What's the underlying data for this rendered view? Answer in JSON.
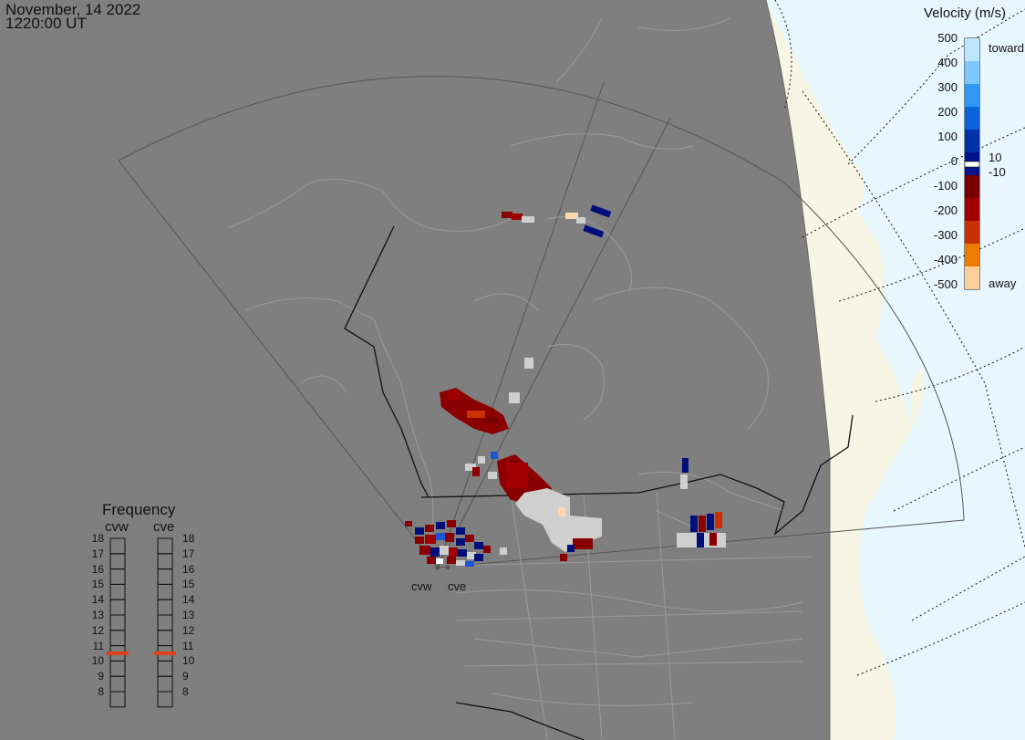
{
  "header": {
    "date": "November, 14 2022",
    "time": "1220:00 UT"
  },
  "velocity_scale": {
    "title": "Velocity (m/s)",
    "ticks": [
      "500",
      "400",
      "300",
      "200",
      "100",
      "0",
      "-100",
      "-200",
      "-300",
      "-400",
      "-500"
    ],
    "labels": {
      "toward": "toward",
      "away": "away",
      "plus_ten": "10",
      "minus_ten": "-10"
    },
    "colors": [
      "#bfe6ff",
      "#7cc7ff",
      "#2f97f5",
      "#0a63d8",
      "#0033aa",
      "#00138a",
      "#7a0000",
      "#a00000",
      "#c83000",
      "#f07a00",
      "#ffcf9a"
    ]
  },
  "frequency_panel": {
    "title": "Frequency",
    "radars": [
      "cvw",
      "cve"
    ],
    "levels": [
      "18",
      "17",
      "16",
      "15",
      "14",
      "13",
      "12",
      "11",
      "10",
      "9",
      "8"
    ],
    "active": {
      "cvw": "11",
      "cve": "11"
    },
    "marker_color": "#e0401a"
  },
  "sites": [
    {
      "name": "cvw"
    },
    {
      "name": "cve"
    }
  ],
  "colors": {
    "land": "#7f7f7f",
    "ocean_day": "#e8f6ff",
    "land_day": "#f7f5e3",
    "gray_scatter": "#cfcfcf"
  }
}
